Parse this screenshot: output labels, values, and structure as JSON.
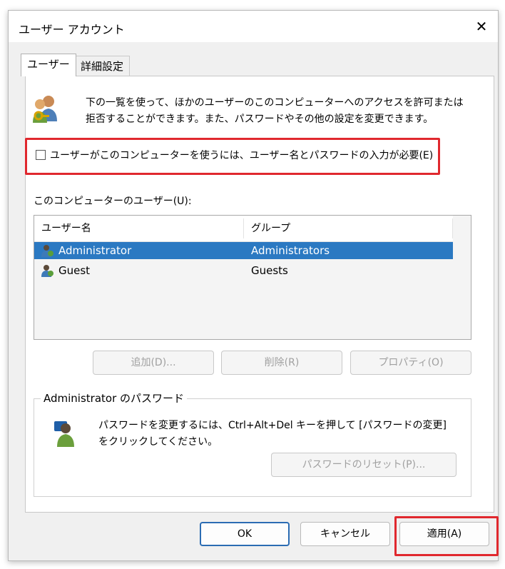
{
  "window": {
    "title": "ユーザー アカウント",
    "close_glyph": "✕"
  },
  "tabs": [
    {
      "label": "ユーザー",
      "active": true
    },
    {
      "label": "詳細設定",
      "active": false
    }
  ],
  "intro": {
    "line1": "下の一覧を使って、ほかのユーザーのこのコンピューターへのアクセスを許可または",
    "line2": "拒否することができます。また、パスワードやその他の設定を変更できます。",
    "icon": "users-keys-icon"
  },
  "require_password": {
    "label": "ユーザーがこのコンピューターを使うには、ユーザー名とパスワードの入力が必要(E)",
    "checked": false
  },
  "users_list": {
    "caption": "このコンピューターのユーザー(U):",
    "columns": [
      "ユーザー名",
      "グループ"
    ],
    "rows": [
      {
        "name": "Administrator",
        "group": "Administrators",
        "selected": true
      },
      {
        "name": "Guest",
        "group": "Guests",
        "selected": false
      }
    ]
  },
  "list_buttons": {
    "add": "追加(D)...",
    "remove": "削除(R)",
    "properties": "プロパティ(O)"
  },
  "password_group": {
    "title": "Administrator のパスワード",
    "line1": "パスワードを変更するには、Ctrl+Alt+Del キーを押して [パスワードの変更]",
    "line2": "をクリックしてください。",
    "reset_button": "パスワードのリセット(P)..."
  },
  "dialog_buttons": {
    "ok": "OK",
    "cancel": "キャンセル",
    "apply": "適用(A)"
  },
  "colors": {
    "highlight": "#e0282e",
    "selection": "#2b79c2",
    "default_button_border": "#2b6cb3"
  }
}
